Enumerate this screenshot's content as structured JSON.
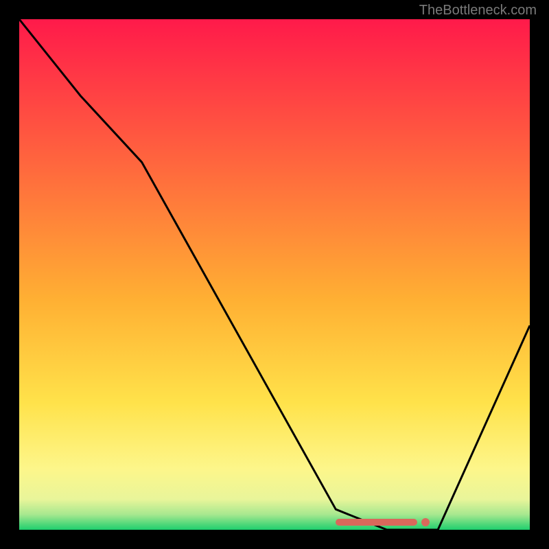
{
  "watermark": "TheBottleneck.com",
  "chart_data": {
    "type": "line",
    "title": "",
    "xlabel": "",
    "ylabel": "",
    "xlim": [
      0,
      100
    ],
    "ylim": [
      0,
      100
    ],
    "grid": false,
    "background": {
      "type": "vertical-gradient",
      "stops": [
        {
          "offset": 0,
          "color": "#ff1a4a"
        },
        {
          "offset": 30,
          "color": "#ff6b3d"
        },
        {
          "offset": 55,
          "color": "#ffb033"
        },
        {
          "offset": 75,
          "color": "#ffe24a"
        },
        {
          "offset": 88,
          "color": "#fdf68a"
        },
        {
          "offset": 94,
          "color": "#e9f59a"
        },
        {
          "offset": 97,
          "color": "#a7e88f"
        },
        {
          "offset": 100,
          "color": "#1ecf6e"
        }
      ]
    },
    "series": [
      {
        "name": "bottleneck-curve",
        "x": [
          0,
          12,
          24,
          62,
          72,
          82,
          100
        ],
        "y": [
          100,
          85,
          72,
          4,
          0,
          0,
          40
        ]
      }
    ],
    "marker": {
      "name": "optimal-range",
      "x_start": 62,
      "x_end": 78,
      "y": 1.5,
      "color": "#d9685b"
    }
  }
}
